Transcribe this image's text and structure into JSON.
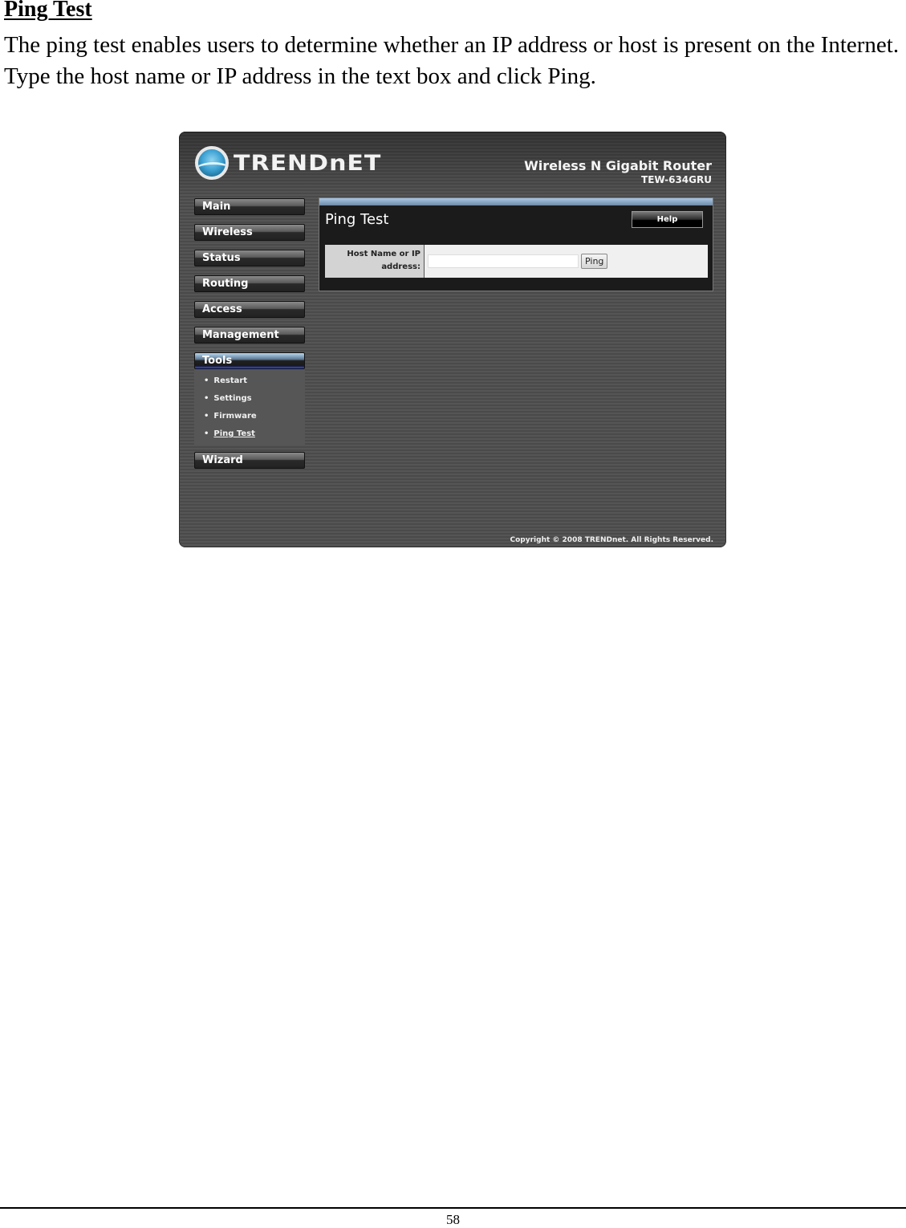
{
  "document": {
    "heading": "Ping Test",
    "paragraph": "The ping test enables users to determine whether an IP address or host is present on the Internet. Type the host name or IP address in the text box and click Ping.",
    "page_number": "58"
  },
  "router_ui": {
    "brand": {
      "logo_text": "TRENDnET",
      "logo_icon": "globe-icon",
      "product_name": "Wireless N Gigabit Router",
      "model": "TEW-634GRU"
    },
    "nav": {
      "items": [
        {
          "label": "Main"
        },
        {
          "label": "Wireless"
        },
        {
          "label": "Status"
        },
        {
          "label": "Routing"
        },
        {
          "label": "Access"
        },
        {
          "label": "Management"
        },
        {
          "label": "Tools",
          "active": true
        },
        {
          "label": "Wizard"
        }
      ],
      "tools_submenu": [
        {
          "label": "Restart"
        },
        {
          "label": "Settings"
        },
        {
          "label": "Firmware"
        },
        {
          "label": "Ping Test",
          "current": true
        }
      ],
      "bullet": "•"
    },
    "panel": {
      "title": "Ping Test",
      "help_label": "Help",
      "field_label_line1": "Host Name or IP",
      "field_label_line2": "address:",
      "host_value": "",
      "host_placeholder": "",
      "ping_label": "Ping"
    },
    "copyright": "Copyright © 2008 TRENDnet. All Rights Reserved.",
    "colors": {
      "background": "#4f4f4f",
      "panel": "#1b1b1b",
      "accent_blue": "#2c3fb8",
      "panel_topbar": "#a9c7e6"
    }
  }
}
